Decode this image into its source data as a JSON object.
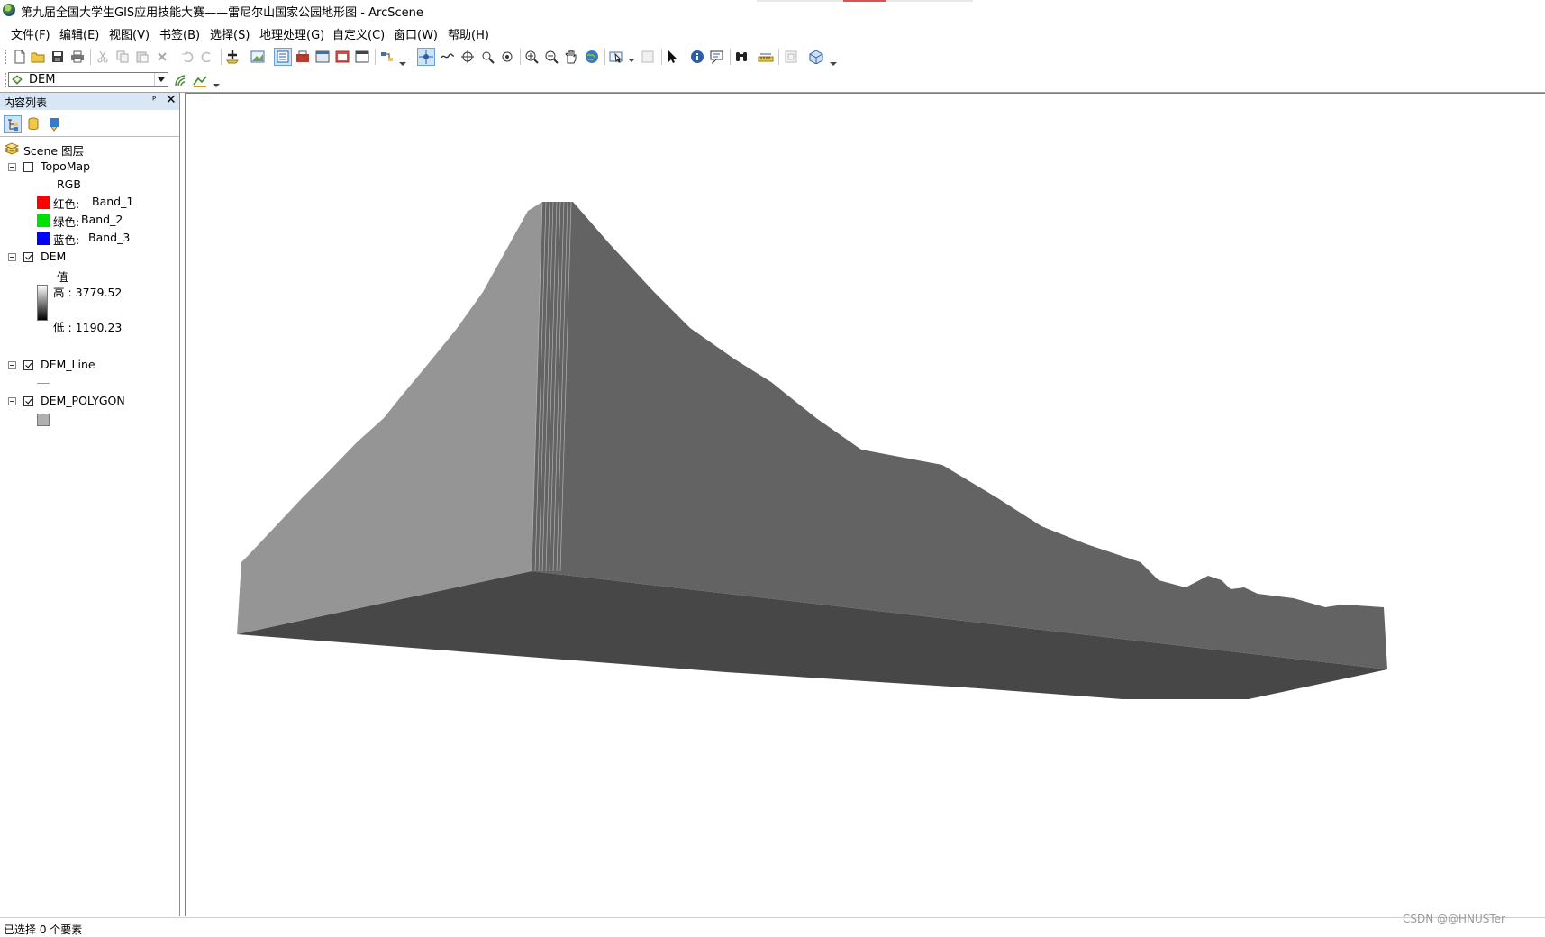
{
  "window": {
    "title": "第九届全国大学生GIS应用技能大赛——雷尼尔山国家公园地形图 - ArcScene"
  },
  "menu": {
    "items": [
      "文件(F)",
      "编辑(E)",
      "视图(V)",
      "书签(B)",
      "选择(S)",
      "地理处理(G)",
      "自定义(C)",
      "窗口(W)",
      "帮助(H)"
    ]
  },
  "toolbar": {
    "buttons": [
      {
        "name": "new-document-icon"
      },
      {
        "name": "open-folder-icon"
      },
      {
        "name": "save-icon"
      },
      {
        "name": "print-icon"
      },
      {
        "name": "cut-icon"
      },
      {
        "name": "copy-icon"
      },
      {
        "name": "paste-icon"
      },
      {
        "name": "delete-icon"
      },
      {
        "name": "undo-icon"
      },
      {
        "name": "redo-icon"
      },
      {
        "name": "add-data-icon"
      },
      {
        "name": "full-extent-icon"
      },
      {
        "name": "table-of-contents-icon"
      },
      {
        "name": "arctoolbox-icon"
      },
      {
        "name": "catalog-icon"
      },
      {
        "name": "search-window-icon"
      },
      {
        "name": "python-window-icon"
      },
      {
        "name": "model-builder-icon"
      },
      {
        "name": "navigate-icon"
      },
      {
        "name": "fly-icon"
      },
      {
        "name": "target-center-icon"
      },
      {
        "name": "zoom-to-target-icon"
      },
      {
        "name": "observer-icon"
      },
      {
        "name": "zoom-in-icon"
      },
      {
        "name": "zoom-out-icon"
      },
      {
        "name": "pan-hand-icon"
      },
      {
        "name": "globe-icon"
      },
      {
        "name": "select-features-icon"
      },
      {
        "name": "clear-selection-icon"
      },
      {
        "name": "select-elements-icon"
      },
      {
        "name": "identify-icon"
      },
      {
        "name": "html-popup-icon"
      },
      {
        "name": "find-binoculars-icon"
      },
      {
        "name": "measure-icon"
      },
      {
        "name": "animation-icon"
      },
      {
        "name": "3d-effects-icon"
      }
    ]
  },
  "layer_selector": {
    "value": "DEM"
  },
  "toc": {
    "title": "内容列表",
    "pin": "ᴾ",
    "close": "✕",
    "root": "Scene 图层",
    "layers": [
      {
        "name": "TopoMap",
        "checked": false,
        "sublabel": "RGB",
        "bands": [
          {
            "label": "红色:",
            "value": "Band_1",
            "color": "#ff0000"
          },
          {
            "label": "绿色:",
            "value": "Band_2",
            "color": "#00e000"
          },
          {
            "label": "蓝色:",
            "value": "Band_3",
            "color": "#0000ff"
          }
        ]
      },
      {
        "name": "DEM",
        "checked": true,
        "sublabel": "值",
        "high": "高 : 3779.52",
        "low": "低 : 1190.23"
      },
      {
        "name": "DEM_Line",
        "checked": true
      },
      {
        "name": "DEM_POLYGON",
        "checked": true,
        "fill": "#b0b0b0"
      }
    ]
  },
  "scene": {
    "colors": {
      "left_face": "#959595",
      "right_face": "#636363",
      "bottom_face": "#474747",
      "background": "#ffffff"
    }
  },
  "status": {
    "text": "已选择 0 个要素"
  },
  "watermark": "CSDN @@HNUSTer"
}
